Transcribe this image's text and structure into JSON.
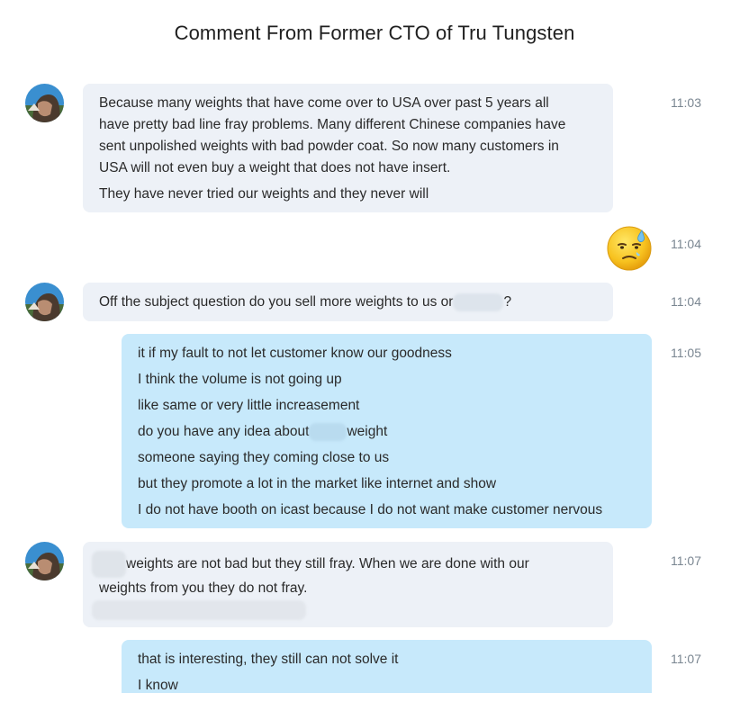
{
  "title": "Comment From Former CTO of Tru Tungsten",
  "messages": [
    {
      "time": "11:03",
      "lines": [
        "Because many weights that have come over to USA over past 5 years all",
        "have pretty bad line fray problems.  Many different Chinese companies have",
        "sent unpolished weights with bad powder coat.  So now many customers in",
        "USA will not even buy a weight that does not have insert.",
        "They have never tried our weights and they never will"
      ]
    },
    {
      "time": "11:04",
      "emoji": "anxious-sweat-face"
    },
    {
      "time": "11:04",
      "line_before": "Off the subject question do you sell more weights to us or",
      "line_after": "?"
    },
    {
      "time": "11:05",
      "lines": [
        "it if my fault to not let customer know our goodness",
        "I think the volume is not going up",
        "like same or very little increasement"
      ],
      "line4_before": "do you have any idea about",
      "line4_after": "weight",
      "lines2": [
        "someone saying they coming close to us",
        "but they promote a lot in the market like internet and show",
        "I do not have booth on icast because I do not want make customer nervous"
      ]
    },
    {
      "time": "11:07",
      "line1_after": "weights are not bad but they still fray.  When we are done with our",
      "line2": "weights from you they do not fray."
    },
    {
      "time": "11:07",
      "lines": [
        "that is interesting, they still can not solve it",
        "I know"
      ]
    }
  ],
  "colors": {
    "incoming_bubble": "#edf1f7",
    "outgoing_bubble": "#c7e9fb",
    "timestamp": "#7a8691"
  }
}
